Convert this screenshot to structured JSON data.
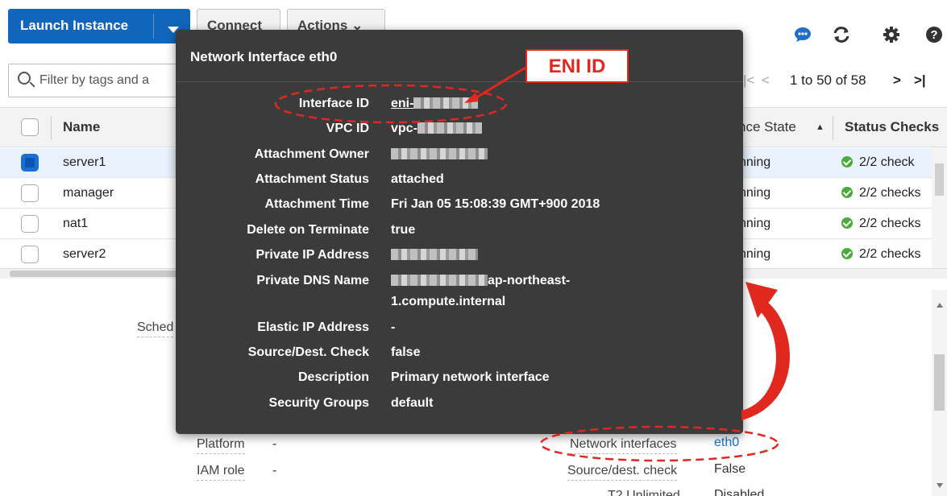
{
  "toolbar": {
    "launch_label": "Launch Instance",
    "connect_label": "Connect",
    "actions_label": "Actions",
    "actions_caret": "⌄"
  },
  "icons": {
    "chat": "chat-bubble-icon",
    "refresh": "refresh-icon",
    "settings": "gear-icon",
    "help": "help-icon"
  },
  "search": {
    "placeholder": "Filter by tags and attributes or search by keyword",
    "visible_text": "Filter by tags and a"
  },
  "pager": {
    "prev_first": "|<",
    "prev": "<",
    "range": "1 to 50 of 58",
    "next": ">",
    "last": ">|"
  },
  "table": {
    "columns": {
      "name": "Name",
      "instance_state": "nce State",
      "sort_arrow": "▲",
      "status_checks": "Status Checks"
    },
    "rows": [
      {
        "name": "server1",
        "state": "nning",
        "checks": "2/2 check",
        "selected": true
      },
      {
        "name": "manager",
        "state": "nning",
        "checks": "2/2 checks",
        "selected": false
      },
      {
        "name": "nat1",
        "state": "nning",
        "checks": "2/2 checks",
        "selected": false
      },
      {
        "name": "server2",
        "state": "nning",
        "checks": "2/2 checks",
        "selected": false
      }
    ]
  },
  "details": {
    "sched_label": "Sched",
    "platform_label": "Platform",
    "platform_value": "-",
    "iam_label": "IAM role",
    "iam_value": "-",
    "network_interfaces_label": "Network interfaces",
    "network_interfaces_value": "eth0",
    "source_dest_label": "Source/dest. check",
    "source_dest_value": "False",
    "t2_label": "T2 Unlimited",
    "t2_value": "Disabled"
  },
  "popover": {
    "title": "Network Interface eth0",
    "fields": [
      {
        "label": "Interface ID",
        "value": "eni-",
        "redacted": true
      },
      {
        "label": "VPC ID",
        "value": "vpc-",
        "redacted": true
      },
      {
        "label": "Attachment Owner",
        "value": "",
        "redacted": true
      },
      {
        "label": "Attachment Status",
        "value": "attached",
        "redacted": false
      },
      {
        "label": "Attachment Time",
        "value": "Fri Jan 05 15:08:39 GMT+900 2018",
        "redacted": false
      },
      {
        "label": "Delete on Terminate",
        "value": "true",
        "redacted": false
      },
      {
        "label": "Private IP Address",
        "value": "",
        "redacted": true
      },
      {
        "label": "Private DNS Name",
        "value": "ap-northeast-",
        "value_line2": "1.compute.internal",
        "redacted": true
      },
      {
        "label": "Elastic IP Address",
        "value": "-",
        "redacted": false
      },
      {
        "label": "Source/Dest. Check",
        "value": "false",
        "redacted": false
      },
      {
        "label": "Description",
        "value": "Primary network interface",
        "redacted": false
      },
      {
        "label": "Security Groups",
        "value": "default",
        "redacted": false
      }
    ]
  },
  "annotation": {
    "callout_text": "ENI ID",
    "color": "#e0281f"
  },
  "colors": {
    "primary": "#1166bb",
    "popover_bg": "#3b3b3b",
    "ok_green": "#4bab3a",
    "link": "#1a6fd0"
  }
}
